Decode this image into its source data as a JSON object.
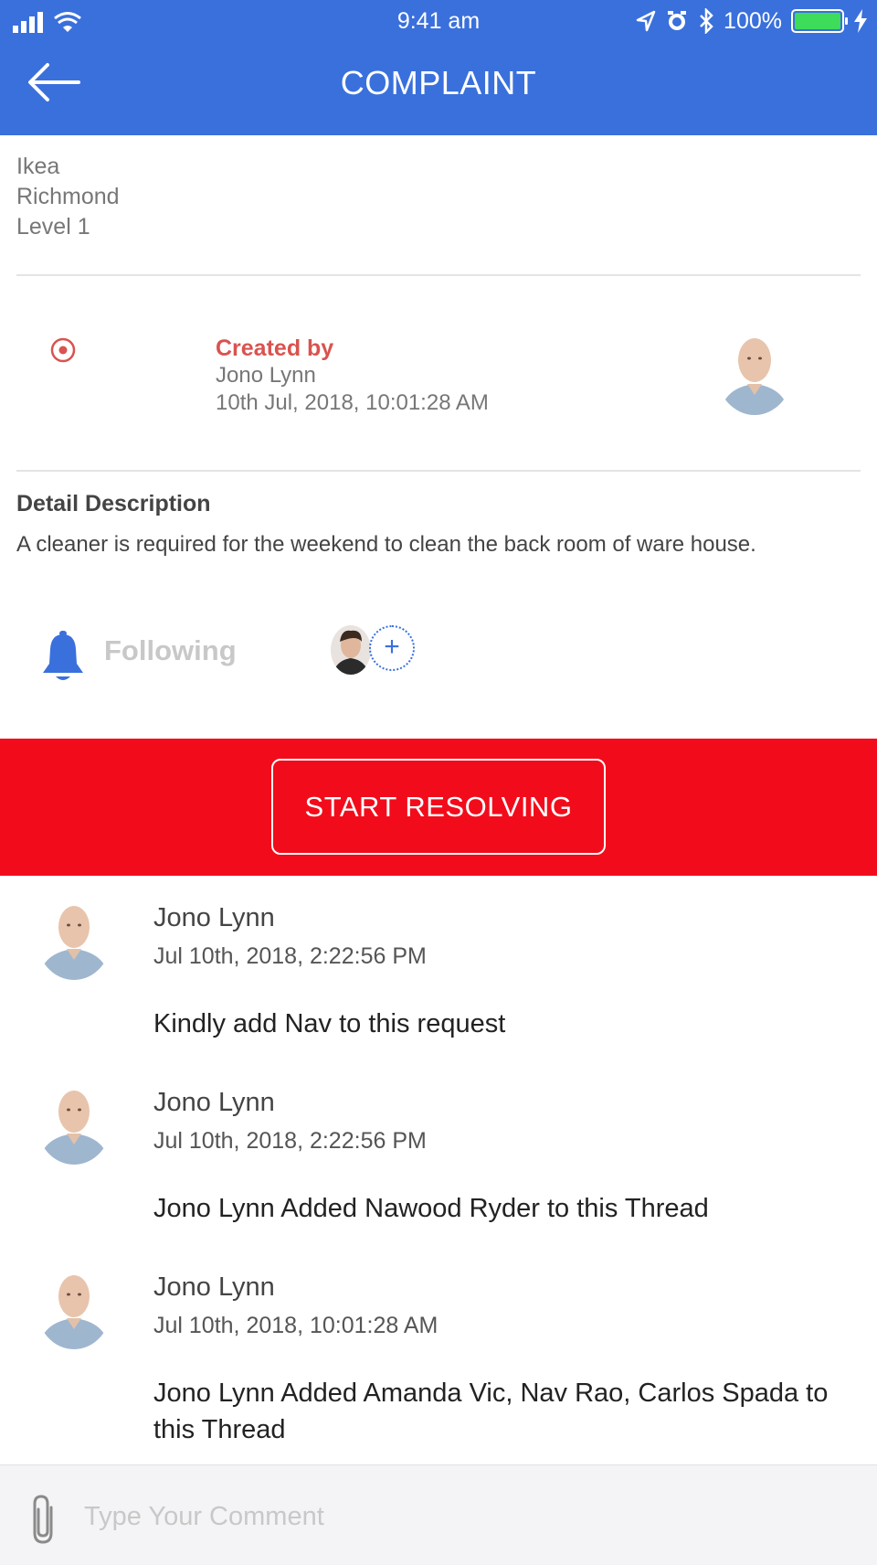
{
  "status_bar": {
    "time": "9:41 am",
    "battery_percent": "100%",
    "icons": [
      "signal-icon",
      "wifi-icon",
      "location-icon",
      "alarm-icon",
      "bluetooth-icon",
      "battery-icon",
      "charging-icon"
    ]
  },
  "header": {
    "title": "COMPLAINT",
    "back_icon": "back-arrow-icon",
    "color": "#3a70dc"
  },
  "location": {
    "store": "Ikea",
    "area": "Richmond",
    "level": "Level 1"
  },
  "created": {
    "label": "Created by",
    "name": "Jono Lynn",
    "timestamp": "10th Jul, 2018, 10:01:28 AM",
    "label_color": "#d9534f"
  },
  "description": {
    "title": "Detail Description",
    "text": "A cleaner is required for the weekend to clean the back room of ware house."
  },
  "following": {
    "label": "Following",
    "add_symbol": "+"
  },
  "action": {
    "button_label": "START RESOLVING",
    "band_color": "#f20c1b"
  },
  "comments": [
    {
      "name": "Jono Lynn",
      "time": "Jul 10th, 2018, 2:22:56 PM",
      "text": "Kindly add Nav to this request"
    },
    {
      "name": "Jono Lynn",
      "time": "Jul 10th, 2018, 2:22:56 PM",
      "text": "Jono Lynn Added Nawood Ryder to this Thread"
    },
    {
      "name": "Jono Lynn",
      "time": "Jul 10th, 2018, 10:01:28 AM",
      "text": "Jono Lynn Added Amanda Vic, Nav Rao, Carlos Spada to this Thread"
    }
  ],
  "comment_input": {
    "placeholder": "Type Your Comment",
    "attach_icon": "paperclip-icon"
  }
}
